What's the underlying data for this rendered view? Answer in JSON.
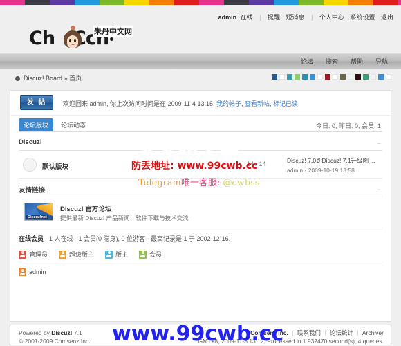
{
  "colorstrip": {
    "colors": [
      "#e8318a",
      "#3a3a42",
      "#5b3a9e",
      "#1f9ad6",
      "#7ab828",
      "#f5d400",
      "#f08000",
      "#e01b1b"
    ],
    "band_width": 36
  },
  "header": {
    "toplinks": {
      "username": "admin",
      "online_label": "在线",
      "items": [
        "提醒",
        "短消息",
        "个人中心",
        "系统设置",
        "退出"
      ]
    },
    "logo": {
      "word_pre": "Ch",
      "word_post": "Ccn",
      "word_tld": "com",
      "cn_name": "朱丹中文网"
    }
  },
  "nav": {
    "items": [
      "论坛",
      "搜索",
      "帮助",
      "导航"
    ]
  },
  "breadcrumb": {
    "root": "Discuz! Board",
    "sep": "»",
    "current": "首页"
  },
  "swatches": {
    "colors": [
      "#2b5a8c",
      "#ffffff",
      "#3f9aa6",
      "#8fce6b",
      "#2f8fb5",
      "#3f8fd0",
      "#ffffff",
      "#9e1b28",
      "#ffffff",
      "#6b6449",
      "#eef2f6",
      "#2a0f0f",
      "#3f9a78",
      "#eef2f6",
      "#3f8fd0",
      "#ffffff"
    ]
  },
  "welcome": {
    "post_button": "发 帖",
    "text_prefix": "欢迎回来",
    "username": "admin",
    "text_mid": ", 你上次访问时间是在",
    "last_visit": "2009-11-4 13:15",
    "links": [
      "我的帖子",
      "查看新帖",
      "标记已读"
    ]
  },
  "tabs": [
    {
      "label": "论坛版块",
      "active": true
    },
    {
      "label": "论坛动态",
      "active": false
    }
  ],
  "stats": "今日: 0, 昨日: 0, 会员: 1",
  "forum_group": {
    "title": "Discuz!",
    "collapse_icon": "−",
    "rows": [
      {
        "name": "默认版块",
        "count": "14 / 14",
        "last_title": "Discuz! 7.0到Discuz! 7.1升级图 ...",
        "last_meta": "admin - 2009-10-19 13:58"
      }
    ]
  },
  "links_group": {
    "title": "友情链接",
    "collapse_icon": "−",
    "rows": [
      {
        "thumb_label": "Discuz!net",
        "title": "Discuz! 官方论坛",
        "desc": "提供最新 Discuz! 产品新闻、软件下载与技术交流"
      }
    ]
  },
  "online": {
    "heading_label": "在线会员",
    "heading_rest": "- 1 人在线 - 1 会员(0 隐身), 0 位游客 - 最高记录是 1 于 2002-12-16.",
    "legend": [
      {
        "label": "管理员",
        "color": "#e8503a"
      },
      {
        "label": "超级版主",
        "color": "#f0a12a"
      },
      {
        "label": "版主",
        "color": "#4fb6e0"
      },
      {
        "label": "会员",
        "color": "#8dc63f"
      }
    ],
    "members": [
      {
        "name": "admin",
        "color": "#f0802a"
      }
    ]
  },
  "footer": {
    "powered_prefix": "Powered by",
    "powered_name": "Discuz!",
    "powered_version": "7.1",
    "copyright": "© 2001-2009 Comsenz Inc.",
    "company": "Comsenz Inc.",
    "links": [
      "联系我们",
      "论坛统计",
      "Archiver"
    ],
    "meta": "GMT+8, 2009-11-8 13:12, Processed in 1.932470 second(s), 4 queries."
  },
  "watermarks": {
    "big": "久久超文本",
    "addr_label": "防丢地址:",
    "addr_url": "www.99cwb.cc",
    "tg_label": "Telegram",
    "tg_cn": "唯一客服:",
    "tg_handle": "@cwbss",
    "bottom": "www.99cwb.cc"
  }
}
